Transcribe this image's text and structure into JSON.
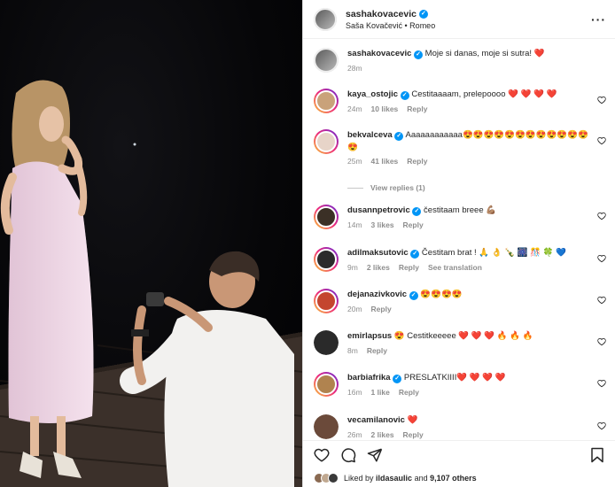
{
  "post": {
    "author": "sashakovacevic",
    "subtitle": "Saša Kovačević • Romeo",
    "caption": "Moje si danas, moje si sutra!",
    "caption_emoji": "❤️",
    "caption_time": "28m"
  },
  "comments": [
    {
      "user": "kaya_ostojic",
      "text": "Cestitaaaam, prelepoooo ❤️ ❤️ ❤️ ❤️",
      "time": "24m",
      "likes": "10 likes",
      "reply": "Reply",
      "avatar_color": "#c9a27a",
      "ring": true
    },
    {
      "user": "bekvalceva",
      "text": "Aaaaaaaaaaaa😍😍😍😍😍😍😍😍😍😍😍😍😍",
      "time": "25m",
      "likes": "41 likes",
      "reply": "Reply",
      "avatar_color": "#e7d4c8",
      "ring": true
    },
    {
      "user": "dusannpetrovic",
      "text": "čestitaam breee 💪🏽",
      "time": "14m",
      "likes": "3 likes",
      "reply": "Reply",
      "avatar_color": "#3b3026",
      "ring": true
    },
    {
      "user": "adilmaksutovic",
      "text": "Čestitam brat ! 🙏 👌 🍾 🎆 🎊 🍀 💙",
      "time": "9m",
      "likes": "2 likes",
      "reply": "Reply",
      "extra": "See translation",
      "avatar_color": "#2b2b2b",
      "ring": true
    },
    {
      "user": "dejanazivkovic",
      "text": "😍😍😍😍",
      "time": "20m",
      "likes": "",
      "reply": "Reply",
      "avatar_color": "#c4452f",
      "ring": true
    },
    {
      "user": "emirlapsus",
      "text": "😍 Cestitkeeeee ❤️ ❤️ ❤️ 🔥 🔥 🔥",
      "time": "8m",
      "likes": "",
      "reply": "Reply",
      "avatar_color": "#2a2a2a",
      "ring": false
    },
    {
      "user": "barbiafrika",
      "text": "PRESLATKIIII❤️ ❤️ ❤️ ❤️",
      "time": "16m",
      "likes": "1 like",
      "reply": "Reply",
      "avatar_color": "#b0834f",
      "ring": true
    },
    {
      "user": "vecamilanovic",
      "text": "❤️",
      "time": "26m",
      "likes": "2 likes",
      "reply": "Reply",
      "avatar_color": "#6b4a3a",
      "ring": false
    }
  ],
  "view_replies": "View replies (1)",
  "footer": {
    "liked_by_prefix": "Liked by",
    "liked_by_user": "ildasaulic",
    "liked_by_and": "and",
    "liked_by_others": "9,107 others"
  },
  "colors": {
    "verified": "#0095f6",
    "muted": "#8e8e8e",
    "border": "#dbdbdb"
  }
}
